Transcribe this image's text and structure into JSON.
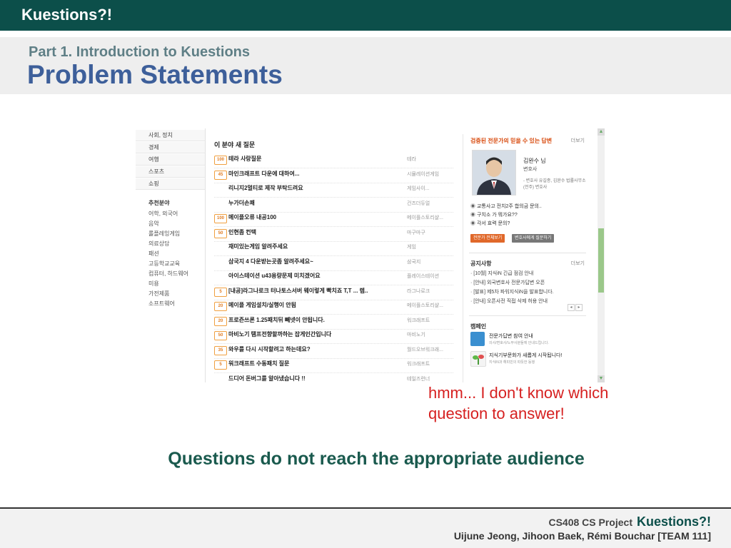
{
  "slide": {
    "brand": "Kuestions?!",
    "subtitle": "Part 1. Introduction to Kuestions",
    "title": "Problem Statements",
    "callout": [
      "hmm... I don't know which",
      "question to answer!"
    ],
    "message": "Questions do not reach the appropriate audience",
    "footer": {
      "project": "CS408 CS Project",
      "name": "Kuestions?!",
      "authors": "Uijune Jeong, Jihoon Baek, Rémi Bouchar [TEAM 111]"
    }
  },
  "screenshot": {
    "left_tabs": [
      "사회, 정치",
      "경제",
      "여행",
      "스포츠",
      "쇼핑"
    ],
    "left_categories_title": "추천분야",
    "left_categories": [
      "어학, 외국어",
      "음악",
      "롤플레잉게임",
      "의료상담",
      "패션",
      "고등학교교육",
      "컴퓨터, 하드웨어",
      "미용",
      "가전제품",
      "소프트웨어"
    ],
    "section_title": "이 분야 새 질문",
    "questions": [
      {
        "badge": "100",
        "text": "테라 사랑질문",
        "cat": "테라"
      },
      {
        "badge": "45",
        "text": "마인크래프트 다운에 대하여...",
        "cat": "시뮬레이션게임"
      },
      {
        "badge": "",
        "text": "리니지2멀티로 제작 부탁드려요",
        "cat": "게임사이..."
      },
      {
        "badge": "",
        "text": "누가더손쾌",
        "cat": "건즈더듀얼"
      },
      {
        "badge": "100",
        "text": "메이플오류 내공100",
        "cat": "메이플스토리샬..."
      },
      {
        "badge": "50",
        "text": "인현좀 컨택",
        "cat": "마구마구"
      },
      {
        "badge": "",
        "text": "재미있는게임 알려주세요",
        "cat": "게임"
      },
      {
        "badge": "",
        "text": "삼국지 4 다운받는곳좀 알려주세요~",
        "cat": "삼국지"
      },
      {
        "badge": "",
        "text": "아이스테이션 u43용량문제 미치겠어요",
        "cat": "플레이스테이션"
      },
      {
        "badge": "5",
        "text": "[내공]라그나로크 터나토스서버 웨이렇게 빡치죠 T,T ... 렙..",
        "cat": "라그나로크"
      },
      {
        "badge": "20",
        "text": "메이플 게임설치/실행이 안됨",
        "cat": "메이플스토리샬..."
      },
      {
        "badge": "20",
        "text": "프로즌쓰론 1.25패치뒤 빼넷이 안됩니다.",
        "cat": "워크래프트"
      },
      {
        "badge": "50",
        "text": "마비노기 탬프전향할까하는 잡게인간입니다",
        "cat": "마비노기"
      },
      {
        "badge": "35",
        "text": "와우를 다시 시작할려고 하는데요?",
        "cat": "월드오브워크래..."
      },
      {
        "badge": "5",
        "text": "워크래프트 수동패치 질문",
        "cat": "워크래프트"
      },
      {
        "badge": "",
        "text": "드디어 돈버그를 알아냈습니다 !!",
        "cat": "테일즈런너"
      }
    ],
    "expert": {
      "header": "검증된 전문가의 믿을 수 있는 답변",
      "more": "더보기",
      "name": "김완수 님",
      "role": "변호사",
      "desc": "- 변호사 유길종, 김완수 법률사무소(전주) 변호사",
      "items": [
        "교통사고 전치2주 합의금 문의..",
        "구치소 가 뭐가요??",
        "각서 효력 문의?"
      ],
      "btn1": "전문가 전체보기",
      "btn2": "변호사에게 질문하기"
    },
    "notice": {
      "title": "공지사항",
      "more": "더보기",
      "items": [
        "· [10월] 지식iN 긴급 점검 안내",
        "· [안내] 외국변호사 전문가답변 오픈",
        "· [발표] 제5차 파워지식iN을 발표합니다.",
        "· [안내] 오픈사전 직접 삭제 허용 안내"
      ]
    },
    "campaign": {
      "title": "캠페인",
      "items": [
        {
          "title": "전문가답변 참여 안내",
          "sub": "의사/변호사/노무사분들께 안내드립니다."
        },
        {
          "title": "지식기부문화가 새롭게 시작됩니다!",
          "sub": "지식iN과 해피빈의 따뜻한 동행"
        }
      ]
    },
    "colors": {
      "accent": "#d84c10",
      "brand": "#0c4f4a",
      "title": "#3d5f9a",
      "callout": "#d62020",
      "badge": "#e07b20"
    }
  }
}
